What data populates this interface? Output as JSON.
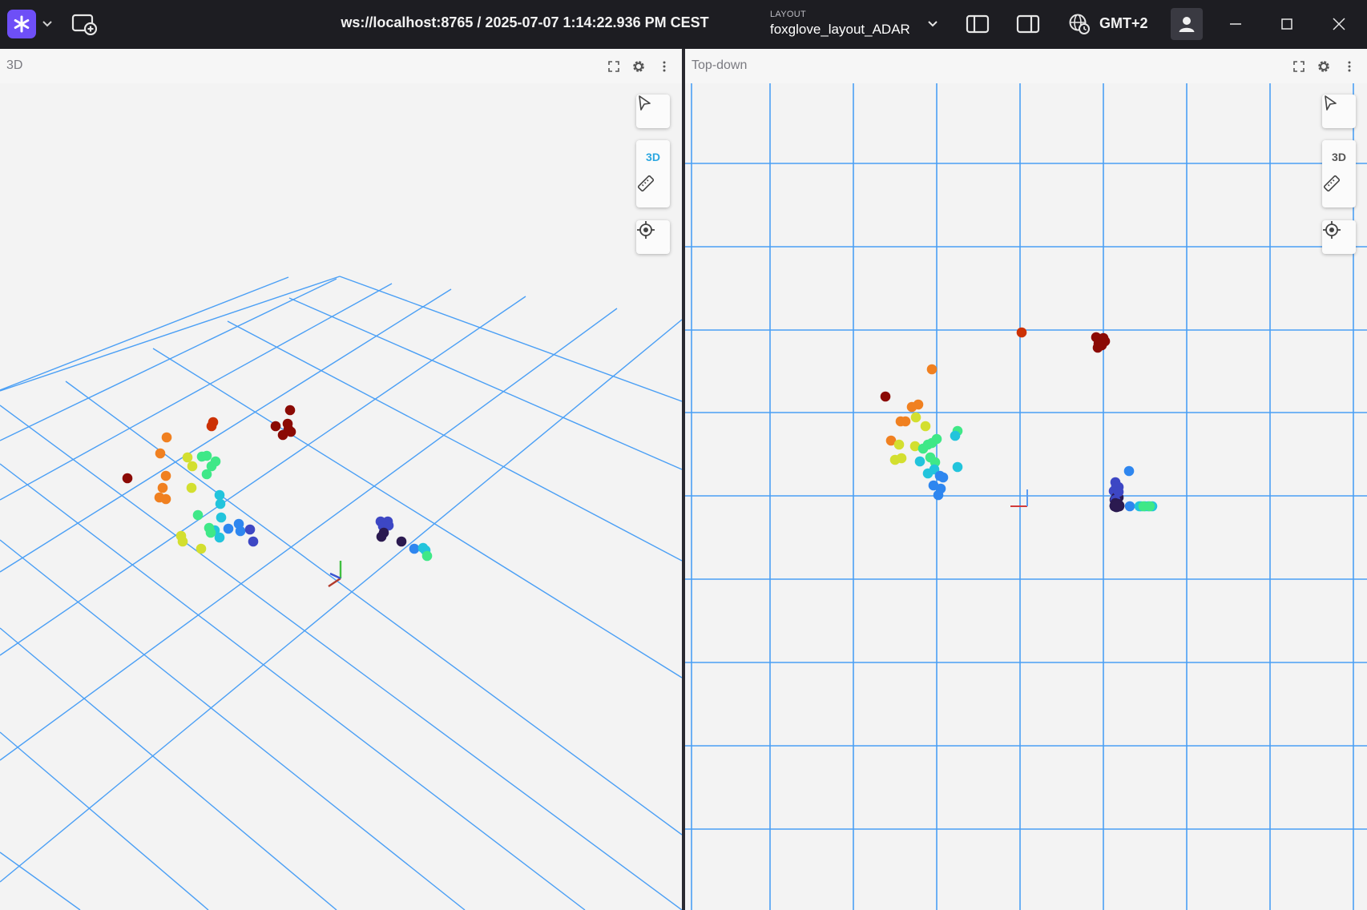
{
  "titlebar": {
    "connection": "ws://localhost:8765 / 2025-07-07 1:14:22.936 PM CEST",
    "layout_caption": "LAYOUT",
    "layout_name": "foxglove_layout_ADAR",
    "timezone": "GMT+2"
  },
  "icons": {
    "logo": "foxglove-logo-icon",
    "new_window": "new-window-icon",
    "left_sidebar": "left-sidebar-icon",
    "right_sidebar": "right-sidebar-icon",
    "timezone": "globe-clock-icon",
    "user": "user-icon",
    "minimize": "minimize-icon",
    "maximize": "maximize-icon",
    "close": "close-icon"
  },
  "colors": {
    "titlebar_bg": "#1d1d22",
    "brand": "#6e4ff7",
    "grid": "#4a9ff5",
    "active_3d": "#2ba7e0"
  },
  "panels": [
    {
      "title": "3D",
      "view_mode_label": "3D",
      "view_mode_active": true
    },
    {
      "title": "Top-down",
      "view_mode_label": "3D",
      "view_mode_active": false
    }
  ],
  "points": [
    {
      "color": "#8b0a04"
    },
    {
      "color": "#cc3104"
    },
    {
      "color": "#f08020"
    },
    {
      "color": "#d3df2f"
    },
    {
      "color": "#3fe887"
    },
    {
      "color": "#22c4dc"
    },
    {
      "color": "#2e86ef"
    },
    {
      "color": "#3d47c4"
    },
    {
      "color": "#2b1a50"
    }
  ]
}
